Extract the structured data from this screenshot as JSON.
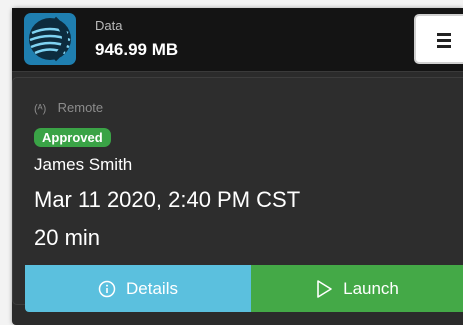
{
  "header": {
    "data_label": "Data",
    "data_value": "946.99 MB",
    "logo_icon": "globe-logo-icon",
    "menu_icon": "hamburger-menu-icon"
  },
  "session": {
    "type_icon": "antenna-icon",
    "type_label": "Remote",
    "status": "Approved",
    "name": "James Smith",
    "datetime": "Mar 11 2020, 2:40 PM CST",
    "duration": "20 min"
  },
  "actions": {
    "details_label": "Details",
    "details_icon": "info-icon",
    "launch_label": "Launch",
    "launch_icon": "play-icon"
  },
  "colors": {
    "details": "#5bc0de",
    "launch": "#44a947",
    "approved": "#3aa346"
  }
}
